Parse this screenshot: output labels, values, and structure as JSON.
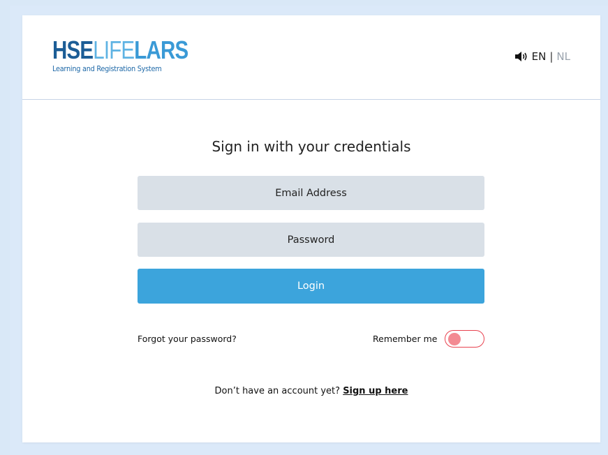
{
  "header": {
    "logo": {
      "part_hse": "HSE",
      "part_life": "LIFE",
      "part_lars": "LARS",
      "subtitle": "Learning and Registration System"
    },
    "language": {
      "icon": "speaker-icon",
      "active": "EN",
      "separator": "|",
      "inactive": "NL"
    }
  },
  "form": {
    "title": "Sign in with your credentials",
    "email": {
      "value": "",
      "placeholder": "Email Address"
    },
    "password": {
      "value": "",
      "placeholder": "Password"
    },
    "login_label": "Login",
    "forgot_label": "Forgot your password?",
    "remember_label": "Remember me",
    "remember_checked": false
  },
  "signup": {
    "prompt": "Don’t have an account yet?",
    "link_label": "Sign up here"
  },
  "colors": {
    "background": "#d9e8f7",
    "primary": "#3ca4dc",
    "field_bg": "#d9e0e7",
    "toggle_off": "#e8424f",
    "logo_dark": "#1c5d96",
    "logo_light": "#5fb3e3"
  }
}
